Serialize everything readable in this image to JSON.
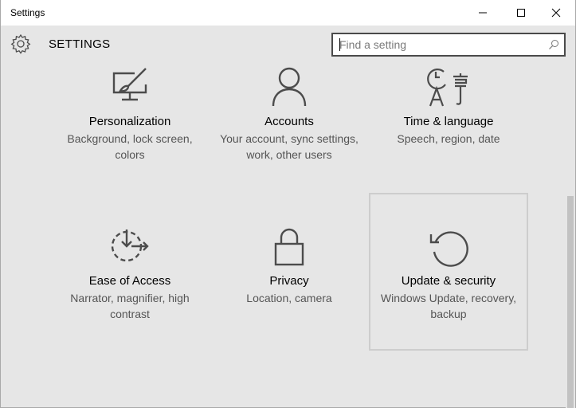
{
  "window": {
    "title": "Settings"
  },
  "header": {
    "title": "SETTINGS",
    "search_placeholder": "Find a setting"
  },
  "categories": [
    {
      "name": "Personalization",
      "description": "Background, lock screen, colors",
      "icon": "personalization-icon"
    },
    {
      "name": "Accounts",
      "description": "Your account, sync settings, work, other users",
      "icon": "person-icon"
    },
    {
      "name": "Time & language",
      "description": "Speech, region, date",
      "icon": "time-language-icon"
    },
    {
      "name": "Ease of Access",
      "description": "Narrator, magnifier, high contrast",
      "icon": "ease-of-access-icon"
    },
    {
      "name": "Privacy",
      "description": "Location, camera",
      "icon": "lock-icon"
    },
    {
      "name": "Update & security",
      "description": "Windows Update, recovery, backup",
      "icon": "refresh-icon",
      "state": "hovered"
    }
  ],
  "colors": {
    "background": "#e6e6e6",
    "icon": "#4c4c4c",
    "description_text": "#555555",
    "hover_border": "#cdcdcd"
  }
}
